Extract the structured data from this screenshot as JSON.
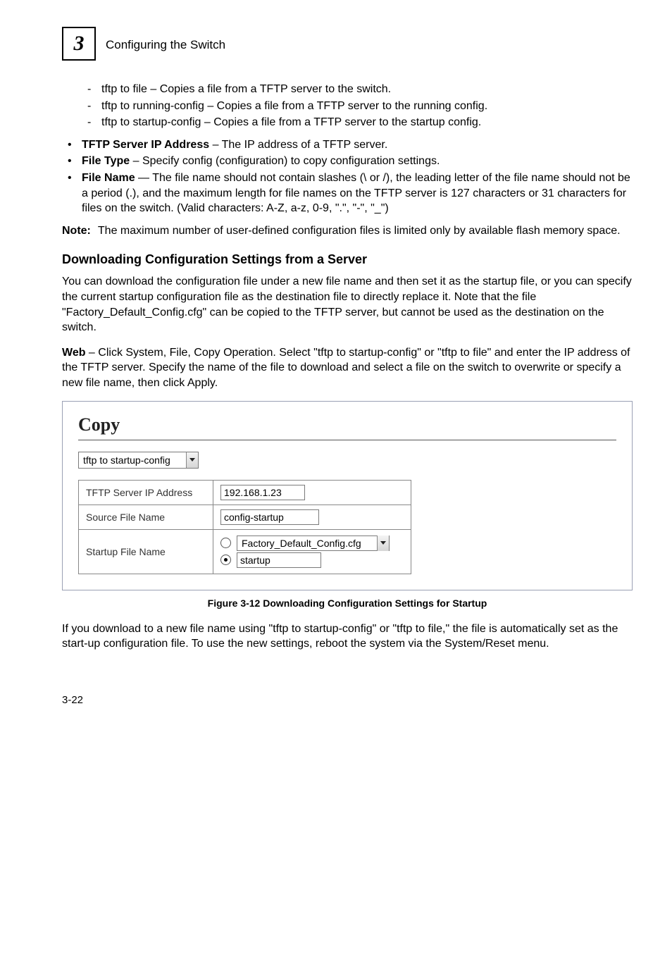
{
  "header": {
    "chapter_num": "3",
    "title": "Configuring the Switch"
  },
  "top_list": {
    "sub_items": [
      "tftp to file – Copies a file from a TFTP server to the switch.",
      "tftp to running-config – Copies a file from a TFTP server to the running config.",
      "tftp to startup-config – Copies a file from a TFTP server to the startup config."
    ],
    "bullets": [
      {
        "bold": "TFTP Server IP Address",
        "rest": " – The IP address of a TFTP server."
      },
      {
        "bold": "File Type",
        "rest": " – Specify config (configuration) to copy configuration settings."
      },
      {
        "bold": "File Name",
        "rest": " — The file name should not contain slashes (\\ or /), the leading letter of the file name should not be a period (.), and the maximum length for file names on the TFTP server is 127 characters or 31 characters for files on the switch. (Valid characters: A-Z, a-z, 0-9, \".\", \"-\", \"_\")"
      }
    ]
  },
  "note": {
    "label": "Note:",
    "text": "The maximum number of user-defined configuration files is limited only by available flash memory space."
  },
  "heading": "Downloading Configuration Settings from a Server",
  "para1": "You can download the configuration file under a new file name and then set it as the startup file, or you can specify the current startup configuration file as the destination file to directly replace it. Note that the file \"Factory_Default_Config.cfg\" can be copied to the TFTP server, but cannot be used as the destination on the switch.",
  "para2_bold": "Web",
  "para2_rest": " – Click System, File, Copy Operation. Select \"tftp to startup-config\" or \"tftp to file\" and enter the IP address of the TFTP server. Specify the name of the file to download and select a file on the switch to overwrite or specify a new file name, then click Apply.",
  "screenshot": {
    "title": "Copy",
    "operation_select": "tftp to startup-config",
    "rows": {
      "ip_label": "TFTP Server IP Address",
      "ip_value": "192.168.1.23",
      "src_label": "Source File Name",
      "src_value": "config-startup",
      "startup_label": "Startup File Name",
      "radio_a_option": "Factory_Default_Config.cfg",
      "radio_b_value": "startup"
    }
  },
  "figure_caption": "Figure 3-12  Downloading Configuration Settings for Startup",
  "para3": "If you download to a new file name using \"tftp to startup-config\" or \"tftp to file,\" the file is automatically set as the start-up configuration file. To use the new settings, reboot the system via the System/Reset menu.",
  "page_number": "3-22"
}
